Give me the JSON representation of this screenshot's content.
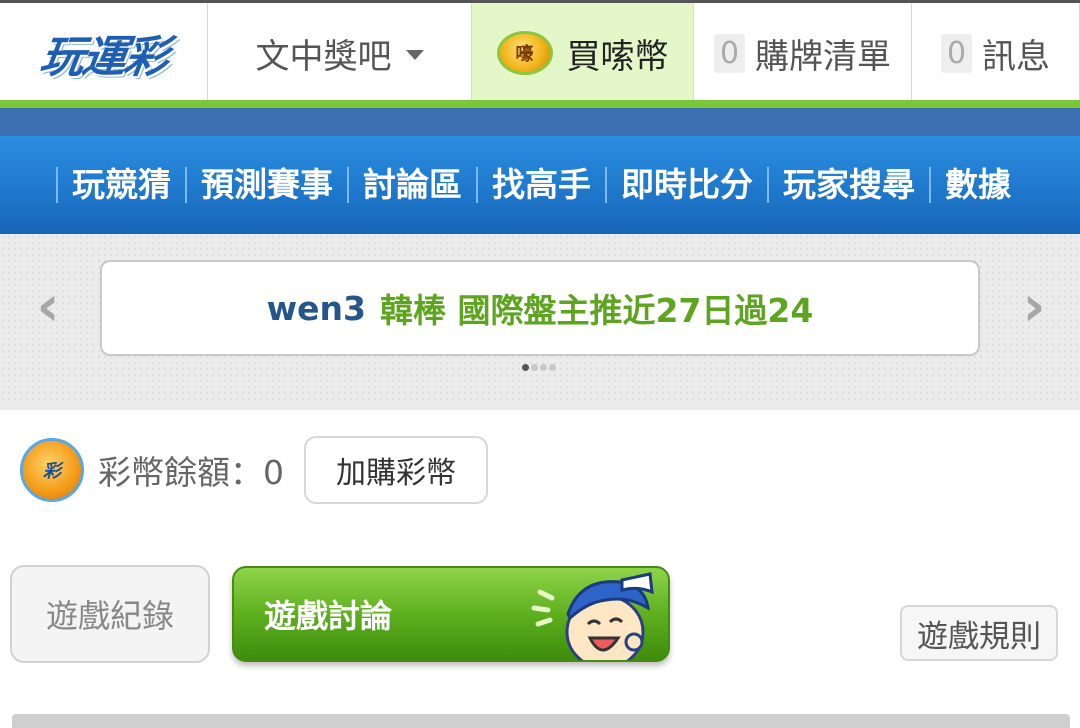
{
  "header": {
    "logo_text": "玩運彩",
    "dropdown_label": "文中獎吧",
    "buy_coin_icon_text": "嚎",
    "buy_coin_label": "買嗦幣",
    "cart_count": "0",
    "cart_label": "購牌清單",
    "msg_count": "0",
    "msg_label": "訊息",
    "accent_color": "#7cc63a"
  },
  "nav": {
    "items": [
      "玩競猜",
      "預測賽事",
      "討論區",
      "找高手",
      "即時比分",
      "玩家搜尋",
      "數據"
    ]
  },
  "banner": {
    "user": "wen3",
    "text": "韓棒 國際盤主推近27日過24",
    "prev_symbol": "‹",
    "next_symbol": "›",
    "active_slide": 1,
    "slide_count": 4
  },
  "balance": {
    "icon_text": "彩",
    "label": "彩幣餘額：0",
    "add_button": "加購彩幣"
  },
  "tabs": {
    "record": "遊戲紀錄",
    "discuss": "遊戲討論",
    "rules": "遊戲規則"
  }
}
